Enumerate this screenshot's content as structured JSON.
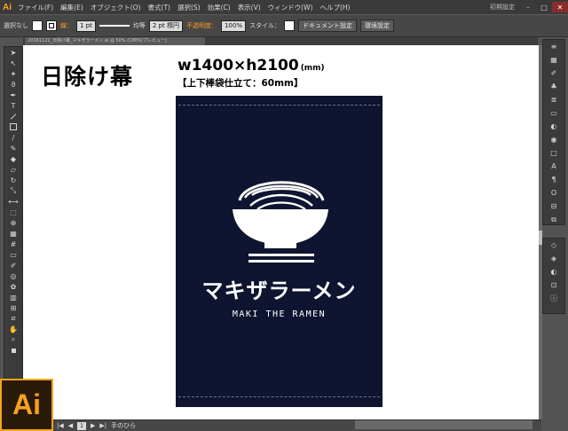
{
  "menubar": {
    "app_icon": "Ai",
    "items": [
      "ファイル(F)",
      "編集(E)",
      "オブジェクト(O)",
      "書式(T)",
      "選択(S)",
      "効果(C)",
      "表示(V)",
      "ウィンドウ(W)",
      "ヘルプ(H)"
    ],
    "workspace": "初期設定"
  },
  "controlbar": {
    "selection": "選択なし",
    "stroke_label": "線：",
    "stroke_weight": "1 pt",
    "profile": "均等",
    "brush": "2 pt 楕円",
    "opacity_label": "不透明度：",
    "opacity_value": "100%",
    "style_label": "スタイル：",
    "doc_settings": "ドキュメント設定",
    "preferences": "環境設定"
  },
  "tab": {
    "label": "20161122_日除け幕_マキザラーメン.ai @ 50% (CMYK/プレビュー)"
  },
  "canvas": {
    "title": "日除け幕",
    "dims_main": "w1400×h2100",
    "dims_unit": "(mm)",
    "bag_note": "【上下棒袋仕立て：60mm】"
  },
  "noren": {
    "background": "#0f1530",
    "jp_text": "マキザラーメン",
    "en_text": "MAKI THE RAMEN"
  },
  "status": {
    "page": "1",
    "tool_name": "手のひら"
  },
  "colors": {
    "accent": "#f7a21b",
    "chrome_dark": "#3a3a3a"
  }
}
